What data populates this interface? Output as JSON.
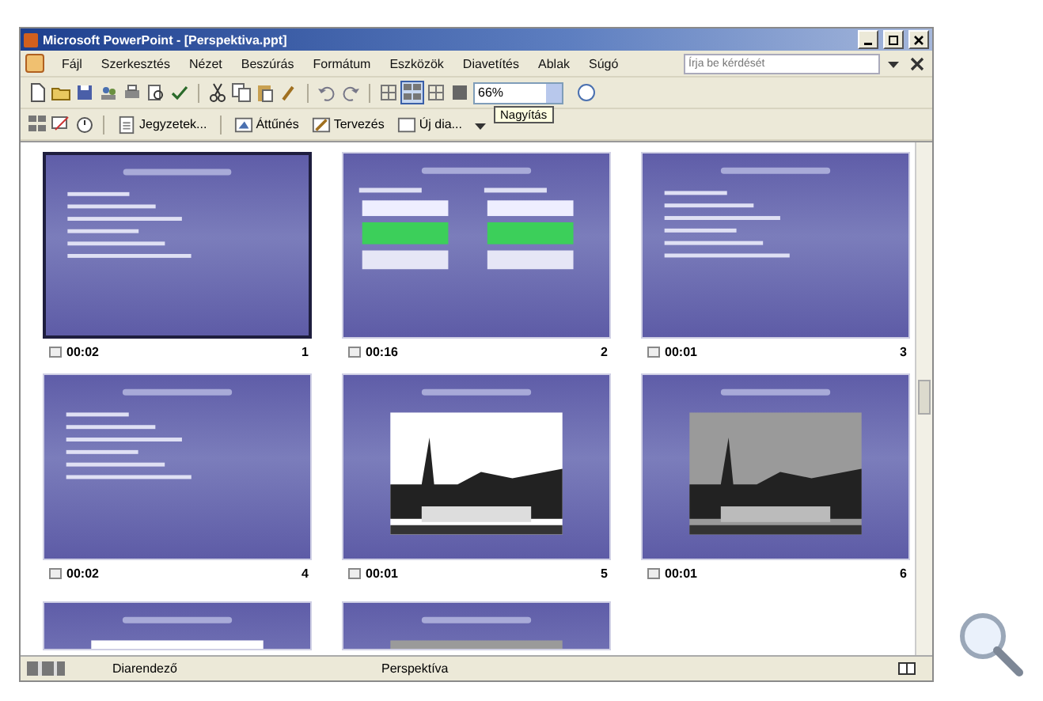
{
  "window": {
    "title": "Microsoft PowerPoint - [Perspektiva.ppt]"
  },
  "menu": [
    "Fájl",
    "Szerkesztés",
    "Nézet",
    "Beszúrás",
    "Formátum",
    "Eszközök",
    "Diavetítés",
    "Ablak",
    "Súgó"
  ],
  "help_box": {
    "placeholder": "Írja be kérdését"
  },
  "zoom_box": {
    "value": "66%"
  },
  "tooltip": "Nagyítás",
  "toolbar_2": [
    {
      "label": "Jegyzetek..."
    },
    {
      "label": "Áttűnés"
    },
    {
      "label": "Tervezés"
    },
    {
      "label": "Új dia..."
    }
  ],
  "slides": [
    {
      "time": "00:02",
      "number": "1",
      "selected": true,
      "kind": "bullets"
    },
    {
      "time": "00:16",
      "number": "2",
      "selected": false,
      "kind": "columns"
    },
    {
      "time": "00:01",
      "number": "3",
      "selected": false,
      "kind": "bullets"
    },
    {
      "time": "00:02",
      "number": "4",
      "selected": false,
      "kind": "bullets"
    },
    {
      "time": "00:01",
      "number": "5",
      "selected": false,
      "kind": "photo"
    },
    {
      "time": "00:01",
      "number": "6",
      "selected": false,
      "kind": "photo"
    },
    {
      "selected": false,
      "kind": "photo"
    },
    {
      "selected": false,
      "kind": "photo"
    }
  ],
  "status_bar": [
    "Diarendező",
    "Perspektíva"
  ]
}
